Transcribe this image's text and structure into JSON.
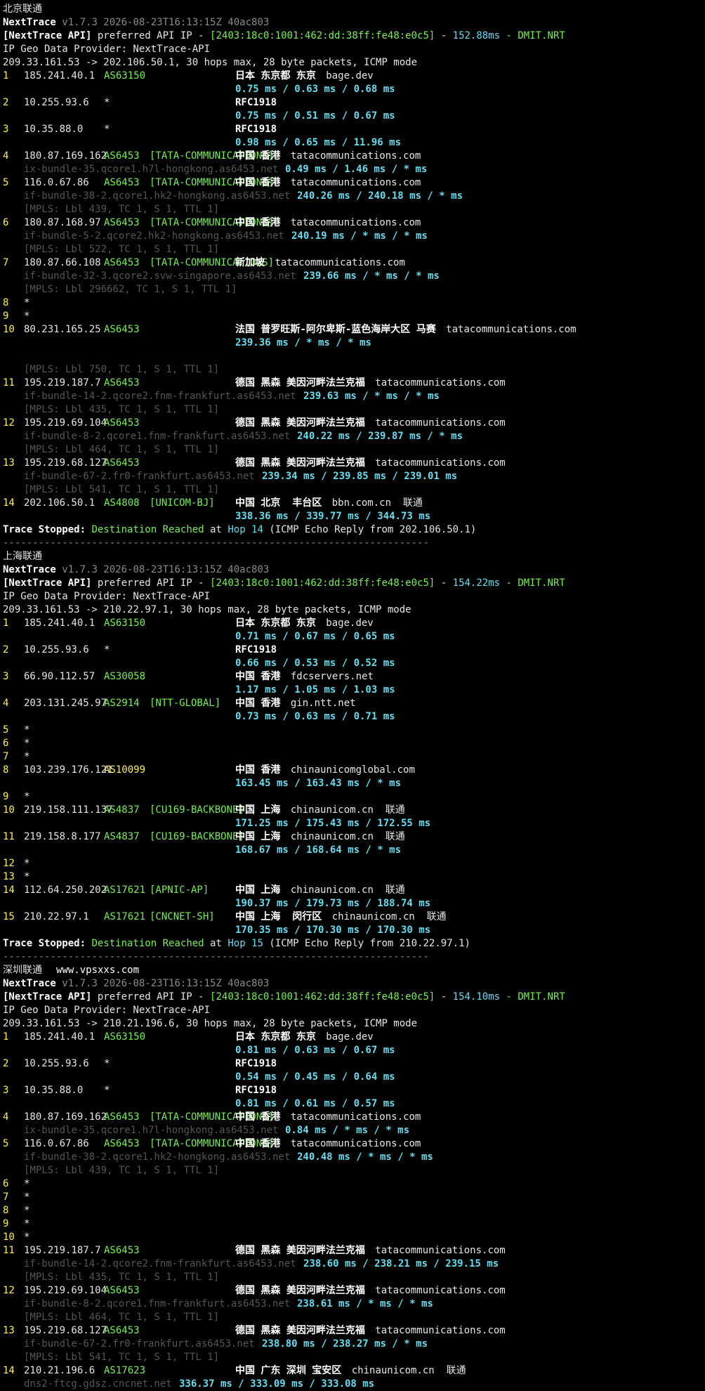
{
  "colors": {
    "background": "#000000",
    "text": "#e6e6e6",
    "hop": "#ffee55",
    "asn": "#77ee55",
    "latency": "#66ddee",
    "muted": "#8a8a8a"
  },
  "sections": [
    {
      "title": "北京联通",
      "watermark": "",
      "version": {
        "app": "NextTrace",
        "info": "v1.7.3 2026-08-23T16:13:15Z 40ac803"
      },
      "api": {
        "label": "[NextTrace API]",
        "text": "preferred API IP -",
        "ip": "[2403:18c0:1001:462:dd:38ff:fe48:e0c5]",
        "sep": "-",
        "latency": "152.88ms",
        "node": "- DMIT.NRT"
      },
      "provider": "IP Geo Data Provider: NextTrace-API",
      "header": "209.33.161.53 -> 202.106.50.1, 30 hops max, 28 byte packets, ICMP mode",
      "hops": [
        {
          "n": "1",
          "ip": "185.241.40.1",
          "asn": "AS63150",
          "org": "",
          "geo": "日本 东京都 东京",
          "domain": "bage.dev",
          "host": "",
          "rtt": "0.75 ms / 0.63 ms / 0.68 ms",
          "mpls": ""
        },
        {
          "n": "2",
          "ip": "10.255.93.6",
          "asn": "*",
          "org": "",
          "geo": "RFC1918",
          "domain": "",
          "host": "",
          "rtt": "0.75 ms / 0.51 ms / 0.67 ms",
          "mpls": ""
        },
        {
          "n": "3",
          "ip": "10.35.88.0",
          "asn": "*",
          "org": "",
          "geo": "RFC1918",
          "domain": "",
          "host": "",
          "rtt": "0.98 ms / 0.65 ms / 11.96 ms",
          "mpls": ""
        },
        {
          "n": "4",
          "ip": "180.87.169.162",
          "asn": "AS6453",
          "org": "[TATA-COMMUNICATIONS]",
          "geo": "中国 香港",
          "domain": "tatacommunications.com",
          "host": "ix-bundle-35.qcore1.h7l-hongkong.as6453.net",
          "rtt": "0.49 ms / 1.46 ms / * ms",
          "mpls": ""
        },
        {
          "n": "5",
          "ip": "116.0.67.86",
          "asn": "AS6453",
          "org": "[TATA-COMMUNICATIONS]",
          "geo": "中国 香港",
          "domain": "tatacommunications.com",
          "host": "if-bundle-38-2.qcore1.hk2-hongkong.as6453.net",
          "rtt": "240.26 ms / 240.18 ms / * ms",
          "mpls": "[MPLS: Lbl 439, TC 1, S 1, TTL 1]"
        },
        {
          "n": "6",
          "ip": "180.87.168.97",
          "asn": "AS6453",
          "org": "[TATA-COMMUNICATIONS]",
          "geo": "中国 香港",
          "domain": "tatacommunications.com",
          "host": "if-bundle-5-2.qcore2.hk2-hongkong.as6453.net",
          "rtt": "240.19 ms / * ms / * ms",
          "mpls": "[MPLS: Lbl 522, TC 1, S 1, TTL 1]"
        },
        {
          "n": "7",
          "ip": "180.87.66.108",
          "asn": "AS6453",
          "org": "[TATA-COMMUNICATIONS]",
          "geo": "新加坡",
          "domain": "tatacommunications.com",
          "host": "if-bundle-32-3.qcore2.svw-singapore.as6453.net",
          "rtt": "239.66 ms / * ms / * ms",
          "mpls": "[MPLS: Lbl 296662, TC 1, S 1, TTL 1]"
        },
        {
          "n": "8",
          "ip": "*",
          "star": true
        },
        {
          "n": "9",
          "ip": "*",
          "star": true
        },
        {
          "n": "10",
          "ip": "80.231.165.25",
          "asn": "AS6453",
          "org": "",
          "geo": "法国 普罗旺斯-阿尔卑斯-蓝色海岸大区 马赛",
          "domain": "tatacommunications.com",
          "host": "",
          "rtt": "239.36 ms / * ms / * ms",
          "mpls": "[MPLS: Lbl 750, TC 1, S 1, TTL 1]",
          "blank_before_mpls": true
        },
        {
          "n": "11",
          "ip": "195.219.187.7",
          "asn": "AS6453",
          "org": "",
          "geo": "德国 黑森 美因河畔法兰克福",
          "domain": "tatacommunications.com",
          "host": "if-bundle-14-2.qcore2.fnm-frankfurt.as6453.net",
          "rtt": "239.63 ms / * ms / * ms",
          "mpls": "[MPLS: Lbl 435, TC 1, S 1, TTL 1]"
        },
        {
          "n": "12",
          "ip": "195.219.69.104",
          "asn": "AS6453",
          "org": "",
          "geo": "德国 黑森 美因河畔法兰克福",
          "domain": "tatacommunications.com",
          "host": "if-bundle-8-2.qcore1.fnm-frankfurt.as6453.net",
          "rtt": "240.22 ms / 239.87 ms / * ms",
          "mpls": "[MPLS: Lbl 464, TC 1, S 1, TTL 1]"
        },
        {
          "n": "13",
          "ip": "195.219.68.127",
          "asn": "AS6453",
          "org": "",
          "geo": "德国 黑森 美因河畔法兰克福",
          "domain": "tatacommunications.com",
          "host": "if-bundle-67-2.fr0-frankfurt.as6453.net",
          "rtt": "239.34 ms / 239.85 ms / 239.01 ms",
          "mpls": "[MPLS: Lbl 541, TC 1, S 1, TTL 1]"
        },
        {
          "n": "14",
          "ip": "202.106.50.1",
          "asn": "AS4808",
          "org": "[UNICOM-BJ]",
          "geo": "中国 北京  丰台区",
          "domain": "bbn.com.cn  联通",
          "host": "",
          "rtt": "338.36 ms / 339.77 ms / 344.73 ms",
          "mpls": ""
        }
      ],
      "stopped": {
        "label": "Trace Stopped:",
        "status": "Destination Reached",
        "at": "at",
        "hop": "Hop 14",
        "detail": "(ICMP Echo Reply from 202.106.50.1)"
      },
      "divider": "------------------------------------------------------------------------"
    },
    {
      "title": "上海联通",
      "watermark": "",
      "version": {
        "app": "NextTrace",
        "info": "v1.7.3 2026-08-23T16:13:15Z 40ac803"
      },
      "api": {
        "label": "[NextTrace API]",
        "text": "preferred API IP -",
        "ip": "[2403:18c0:1001:462:dd:38ff:fe48:e0c5]",
        "sep": "-",
        "latency": "154.22ms",
        "node": "- DMIT.NRT"
      },
      "provider": "IP Geo Data Provider: NextTrace-API",
      "header": "209.33.161.53 -> 210.22.97.1, 30 hops max, 28 byte packets, ICMP mode",
      "hops": [
        {
          "n": "1",
          "ip": "185.241.40.1",
          "asn": "AS63150",
          "org": "",
          "geo": "日本 东京都 东京",
          "domain": "bage.dev",
          "host": "",
          "rtt": "0.71 ms / 0.67 ms / 0.65 ms",
          "mpls": ""
        },
        {
          "n": "2",
          "ip": "10.255.93.6",
          "asn": "*",
          "org": "",
          "geo": "RFC1918",
          "domain": "",
          "host": "",
          "rtt": "0.66 ms / 0.53 ms / 0.52 ms",
          "mpls": ""
        },
        {
          "n": "3",
          "ip": "66.90.112.57",
          "asn": "AS30058",
          "org": "",
          "geo": "中国 香港",
          "domain": "fdcservers.net",
          "host": "",
          "rtt": "1.17 ms / 1.05 ms / 1.03 ms",
          "mpls": ""
        },
        {
          "n": "4",
          "ip": "203.131.245.97",
          "asn": "AS2914",
          "org": "[NTT-GLOBAL]",
          "geo": "中国 香港",
          "domain": "gin.ntt.net",
          "host": "",
          "rtt": "0.73 ms / 0.63 ms / 0.71 ms",
          "mpls": ""
        },
        {
          "n": "5",
          "ip": "*",
          "star": true
        },
        {
          "n": "6",
          "ip": "*",
          "star": true
        },
        {
          "n": "7",
          "ip": "*",
          "star": true
        },
        {
          "n": "8",
          "ip": "103.239.176.121",
          "asn": "AS10099",
          "asn_y": true,
          "org": "",
          "geo": "中国 香港",
          "domain": "chinaunicomglobal.com",
          "host": "",
          "rtt": "163.45 ms / 163.43 ms / * ms",
          "mpls": ""
        },
        {
          "n": "9",
          "ip": "*",
          "star": true
        },
        {
          "n": "10",
          "ip": "219.158.111.137",
          "asn": "AS4837",
          "org": "[CU169-BACKBONE]",
          "geo": "中国 上海",
          "domain": "chinaunicom.cn  联通",
          "host": "",
          "rtt": "171.25 ms / 175.43 ms / 172.55 ms",
          "mpls": ""
        },
        {
          "n": "11",
          "ip": "219.158.8.177",
          "asn": "AS4837",
          "org": "[CU169-BACKBONE]",
          "geo": "中国 上海",
          "domain": "chinaunicom.cn  联通",
          "host": "",
          "rtt": "168.67 ms / 168.64 ms / * ms",
          "mpls": ""
        },
        {
          "n": "12",
          "ip": "*",
          "star": true
        },
        {
          "n": "13",
          "ip": "*",
          "star": true
        },
        {
          "n": "14",
          "ip": "112.64.250.202",
          "asn": "AS17621",
          "org": "[APNIC-AP]",
          "geo": "中国 上海",
          "domain": "chinaunicom.cn  联通",
          "host": "",
          "rtt": "190.37 ms / 179.73 ms / 188.74 ms",
          "mpls": ""
        },
        {
          "n": "15",
          "ip": "210.22.97.1",
          "asn": "AS17621",
          "org": "[CNCNET-SH]",
          "geo": "中国 上海  闵行区",
          "domain": "chinaunicom.cn  联通",
          "host": "",
          "rtt": "170.35 ms / 170.30 ms / 170.30 ms",
          "mpls": ""
        }
      ],
      "stopped": {
        "label": "Trace Stopped:",
        "status": "Destination Reached",
        "at": "at",
        "hop": "Hop 15",
        "detail": "(ICMP Echo Reply from 210.22.97.1)"
      },
      "divider": "------------------------------------------------------------------------"
    },
    {
      "title": "深圳联通",
      "watermark": "www.vpsxxs.com",
      "version": {
        "app": "NextTrace",
        "info": "v1.7.3 2026-08-23T16:13:15Z 40ac803"
      },
      "api": {
        "label": "[NextTrace API]",
        "text": "preferred API IP -",
        "ip": "[2403:18c0:1001:462:dd:38ff:fe48:e0c5]",
        "sep": "-",
        "latency": "154.10ms",
        "node": "- DMIT.NRT"
      },
      "provider": "IP Geo Data Provider: NextTrace-API",
      "header": "209.33.161.53 -> 210.21.196.6, 30 hops max, 28 byte packets, ICMP mode",
      "hops": [
        {
          "n": "1",
          "ip": "185.241.40.1",
          "asn": "AS63150",
          "org": "",
          "geo": "日本 东京都 东京",
          "domain": "bage.dev",
          "host": "",
          "rtt": "0.81 ms / 0.63 ms / 0.67 ms",
          "mpls": ""
        },
        {
          "n": "2",
          "ip": "10.255.93.6",
          "asn": "*",
          "org": "",
          "geo": "RFC1918",
          "domain": "",
          "host": "",
          "rtt": "0.54 ms / 0.45 ms / 0.64 ms",
          "mpls": ""
        },
        {
          "n": "3",
          "ip": "10.35.88.0",
          "asn": "*",
          "org": "",
          "geo": "RFC1918",
          "domain": "",
          "host": "",
          "rtt": "0.81 ms / 0.61 ms / 0.57 ms",
          "mpls": ""
        },
        {
          "n": "4",
          "ip": "180.87.169.162",
          "asn": "AS6453",
          "org": "[TATA-COMMUNICATIONS]",
          "geo": "中国 香港",
          "domain": "tatacommunications.com",
          "host": "ix-bundle-35.qcore1.h7l-hongkong.as6453.net",
          "rtt": "0.84 ms / * ms / * ms",
          "mpls": ""
        },
        {
          "n": "5",
          "ip": "116.0.67.86",
          "asn": "AS6453",
          "org": "[TATA-COMMUNICATIONS]",
          "geo": "中国 香港",
          "domain": "tatacommunications.com",
          "host": "if-bundle-38-2.qcore1.hk2-hongkong.as6453.net",
          "rtt": "240.48 ms / * ms / * ms",
          "mpls": "[MPLS: Lbl 439, TC 1, S 1, TTL 1]"
        },
        {
          "n": "6",
          "ip": "*",
          "star": true
        },
        {
          "n": "7",
          "ip": "*",
          "star": true
        },
        {
          "n": "8",
          "ip": "*",
          "star": true
        },
        {
          "n": "9",
          "ip": "*",
          "star": true
        },
        {
          "n": "10",
          "ip": "*",
          "star": true
        },
        {
          "n": "11",
          "ip": "195.219.187.7",
          "asn": "AS6453",
          "org": "",
          "geo": "德国 黑森 美因河畔法兰克福",
          "domain": "tatacommunications.com",
          "host": "if-bundle-14-2.qcore2.fnm-frankfurt.as6453.net",
          "rtt": "238.60 ms / 238.21 ms / 239.15 ms",
          "mpls": "[MPLS: Lbl 435, TC 1, S 1, TTL 1]"
        },
        {
          "n": "12",
          "ip": "195.219.69.104",
          "asn": "AS6453",
          "org": "",
          "geo": "德国 黑森 美因河畔法兰克福",
          "domain": "tatacommunications.com",
          "host": "if-bundle-8-2.qcore1.fnm-frankfurt.as6453.net",
          "rtt": "238.61 ms / * ms / * ms",
          "mpls": "[MPLS: Lbl 464, TC 1, S 1, TTL 1]"
        },
        {
          "n": "13",
          "ip": "195.219.68.127",
          "asn": "AS6453",
          "org": "",
          "geo": "德国 黑森 美因河畔法兰克福",
          "domain": "tatacommunications.com",
          "host": "if-bundle-67-2.fr0-frankfurt.as6453.net",
          "rtt": "238.80 ms / 238.27 ms / * ms",
          "mpls": "[MPLS: Lbl 541, TC 1, S 1, TTL 1]"
        },
        {
          "n": "14",
          "ip": "210.21.196.6",
          "asn": "AS17623",
          "org": "",
          "geo": "中国 广东 深圳 宝安区",
          "domain": "chinaunicom.cn  联通",
          "host": "dns2-ftcg.gdsz.cncnet.net",
          "rtt": "336.37 ms / 333.09 ms / 333.08 ms",
          "mpls": ""
        }
      ],
      "stopped": null,
      "divider": ""
    }
  ]
}
